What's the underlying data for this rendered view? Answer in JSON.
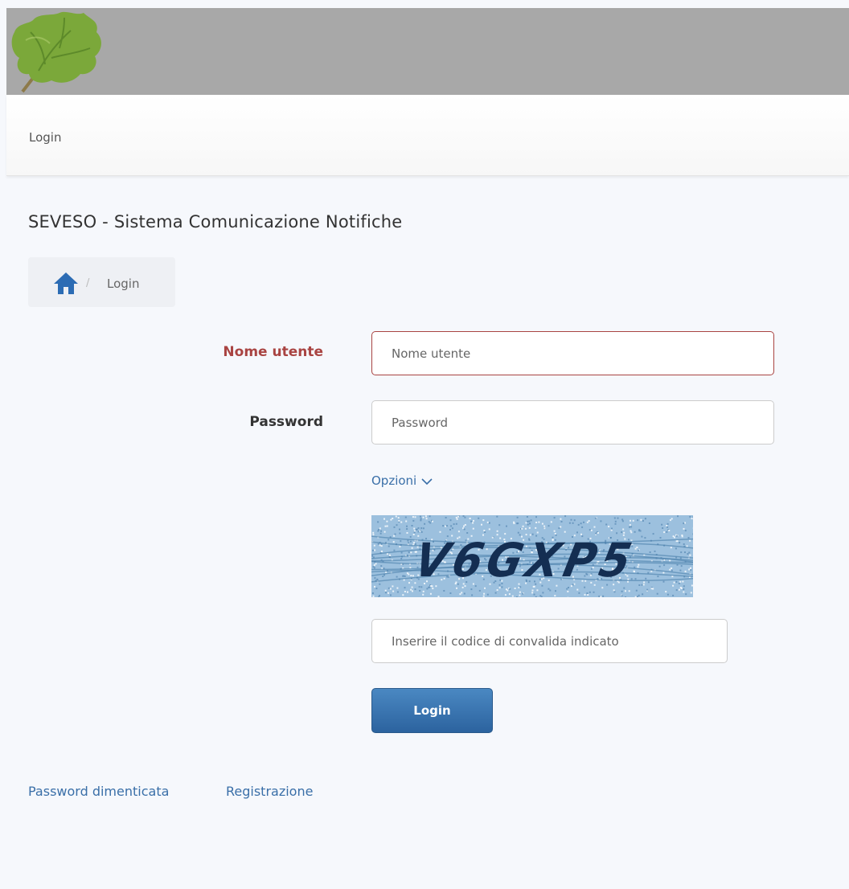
{
  "navbar": {
    "login_label": "Login"
  },
  "page": {
    "title": "SEVESO - Sistema Comunicazione Notifiche"
  },
  "breadcrumb": {
    "current": "Login",
    "separator": "/"
  },
  "form": {
    "username_label": "Nome utente",
    "username_placeholder": "Nome utente",
    "password_label": "Password",
    "password_placeholder": "Password",
    "options_label": "Opzioni",
    "captcha_code": "V6GXP5",
    "captcha_placeholder": "Inserire il codice di convalida indicato",
    "submit_label": "Login"
  },
  "links": {
    "forgot_password": "Password dimenticata",
    "register": "Registrazione"
  },
  "colors": {
    "error": "#a94442",
    "link": "#3a6fa8",
    "button": "#2c639f",
    "banner": "#a8a8a8"
  },
  "icons": {
    "logo": "leaf-logo-icon",
    "home": "home-icon",
    "options": "chevron-down-icon"
  }
}
